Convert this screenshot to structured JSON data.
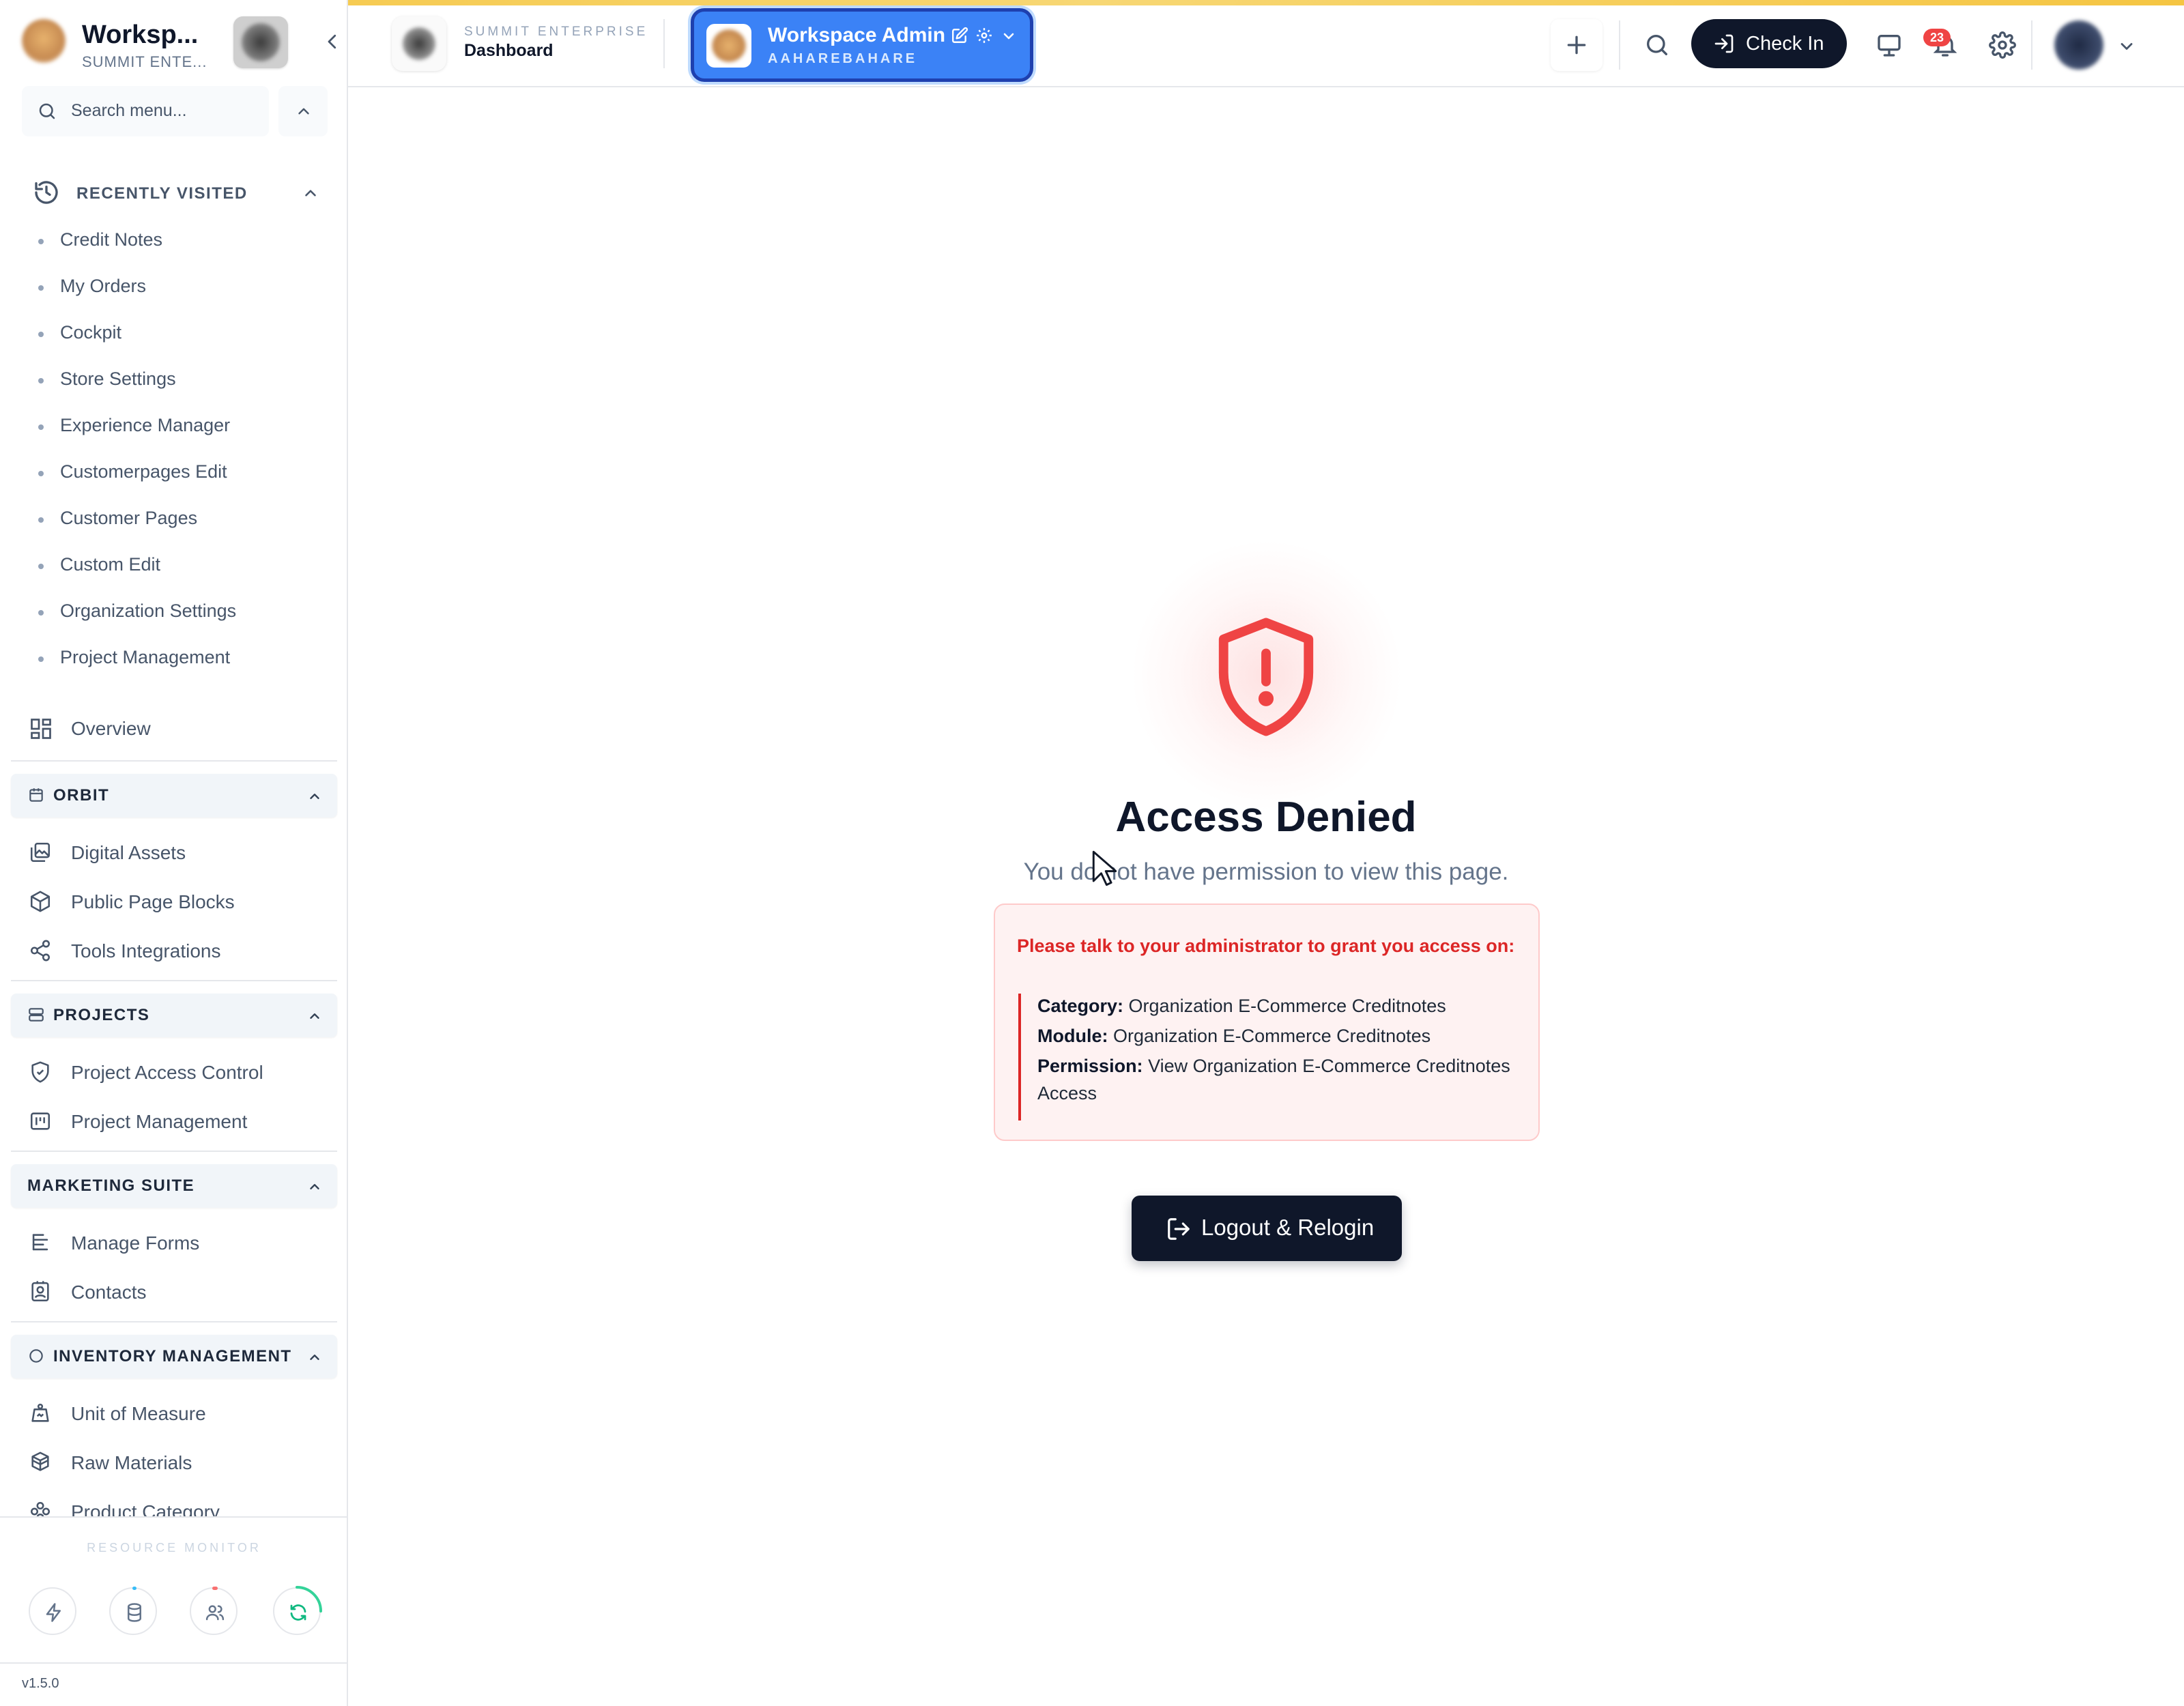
{
  "sidebar": {
    "workspace_title": "Worksp...",
    "workspace_sub": "SUMMIT ENTE...",
    "search_placeholder": "Search menu...",
    "recently_visited_label": "RECENTLY VISITED",
    "recent_items": [
      "Credit Notes",
      "My Orders",
      "Cockpit",
      "Store Settings",
      "Experience Manager",
      "Customerpages Edit",
      "Customer Pages",
      "Custom Edit",
      "Organization Settings",
      "Project Management"
    ],
    "overview_label": "Overview",
    "sections": {
      "orbit": {
        "label": "ORBIT",
        "items": [
          "Digital Assets",
          "Public Page Blocks",
          "Tools Integrations"
        ]
      },
      "projects": {
        "label": "PROJECTS",
        "items": [
          "Project Access Control",
          "Project Management"
        ]
      },
      "marketing": {
        "label": "MARKETING SUITE",
        "items": [
          "Manage Forms",
          "Contacts"
        ]
      },
      "inventory": {
        "label": "INVENTORY MANAGEMENT",
        "items": [
          "Unit of Measure",
          "Raw Materials",
          "Product Category"
        ]
      }
    },
    "resource_monitor_label": "RESOURCE MONITOR",
    "version": "v1.5.0"
  },
  "header": {
    "org_label": "SUMMIT ENTERPRISE",
    "page_label": "Dashboard",
    "workspace_name": "Workspace Admin",
    "workspace_code": "AAHAREBAHARE",
    "check_in_label": "Check In",
    "notification_count": "23"
  },
  "main": {
    "title": "Access Denied",
    "message": "You do not have permission to view this page.",
    "notice_heading": "Please talk to your administrator to grant you access on:",
    "category_label": "Category:",
    "category_value": "Organization E-Commerce Creditnotes",
    "module_label": "Module:",
    "module_value": "Organization E-Commerce Creditnotes",
    "permission_label": "Permission:",
    "permission_value": "View Organization E-Commerce Creditnotes Access",
    "logout_label": "Logout & Relogin"
  },
  "colors": {
    "accent_blue": "#3b82f6",
    "danger_red": "#dc2626",
    "dark_navy": "#0f172a",
    "top_stripe": "#f5c542"
  }
}
